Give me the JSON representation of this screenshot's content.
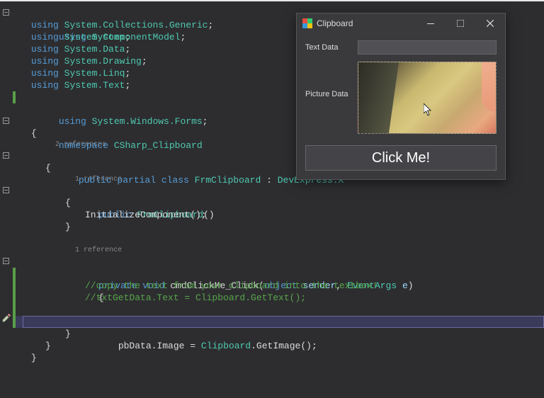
{
  "code": {
    "usings": [
      {
        "ns": "System"
      },
      {
        "ns": "System.Collections.Generic"
      },
      {
        "ns": "System.ComponentModel"
      },
      {
        "ns": "System.Data"
      },
      {
        "ns": "System.Drawing"
      },
      {
        "ns": "System.Linq"
      },
      {
        "ns": "System.Text"
      },
      {
        "ns": "System.Windows.Forms"
      }
    ],
    "namespace_kw": "namespace",
    "namespace_name": "CSharp_Clipboard",
    "class_codelens": "2 references",
    "class_decl": {
      "mods": "public partial class",
      "name": "FrmClipboard",
      "base": "DevExpress.X"
    },
    "ctor_codelens": "1 reference",
    "ctor_name": "FrmClipboard",
    "init_call": "InitializeComponent",
    "handler_codelens": "1 reference",
    "handler": {
      "mods": "private void",
      "name": "cmdClickMe_Click",
      "p1type": "object",
      "p1name": "sender",
      "p2type": "EventArgs",
      "p2name": "e"
    },
    "comment1": "//copy the text from your clipboard into the textbox!",
    "comment2": "//txtGetData.Text = Clipboard.GetText();",
    "active_line": {
      "lhs_obj": "pbData",
      "lhs_prop": "Image",
      "rhs_class": "Clipboard",
      "rhs_method": "GetImage"
    },
    "using_kw": "using"
  },
  "form": {
    "title": "Clipboard",
    "label_text": "Text Data",
    "label_pic": "Picture Data",
    "button": "Click Me!"
  }
}
